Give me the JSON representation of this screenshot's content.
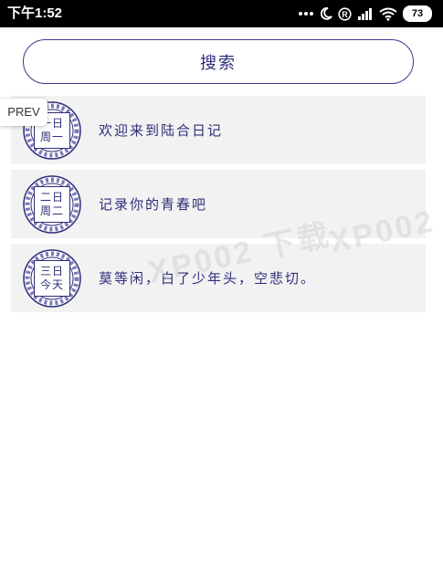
{
  "status_bar": {
    "time": "下午1:52",
    "battery": "73",
    "icons": [
      "dots-icon",
      "moon-icon",
      "registered-icon",
      "signal-icon",
      "wifi-icon",
      "battery-icon"
    ]
  },
  "search": {
    "label": "搜索"
  },
  "prev_tag": "PREV",
  "diary": [
    {
      "date_line1": "一日",
      "date_line2": "周一",
      "title": "欢迎来到陆合日记"
    },
    {
      "date_line1": "二日",
      "date_line2": "周二",
      "title": "记录你的青春吧"
    },
    {
      "date_line1": "三日",
      "date_line2": "今天",
      "title": "莫等闲，白了少年头，空悲切。"
    }
  ],
  "watermark": {
    "text_1": "XP002 下载",
    "text_2": "XP002"
  },
  "colors": {
    "accent": "#2e2e7a",
    "item_bg": "#f2f2f2",
    "status_bg": "#000000"
  }
}
